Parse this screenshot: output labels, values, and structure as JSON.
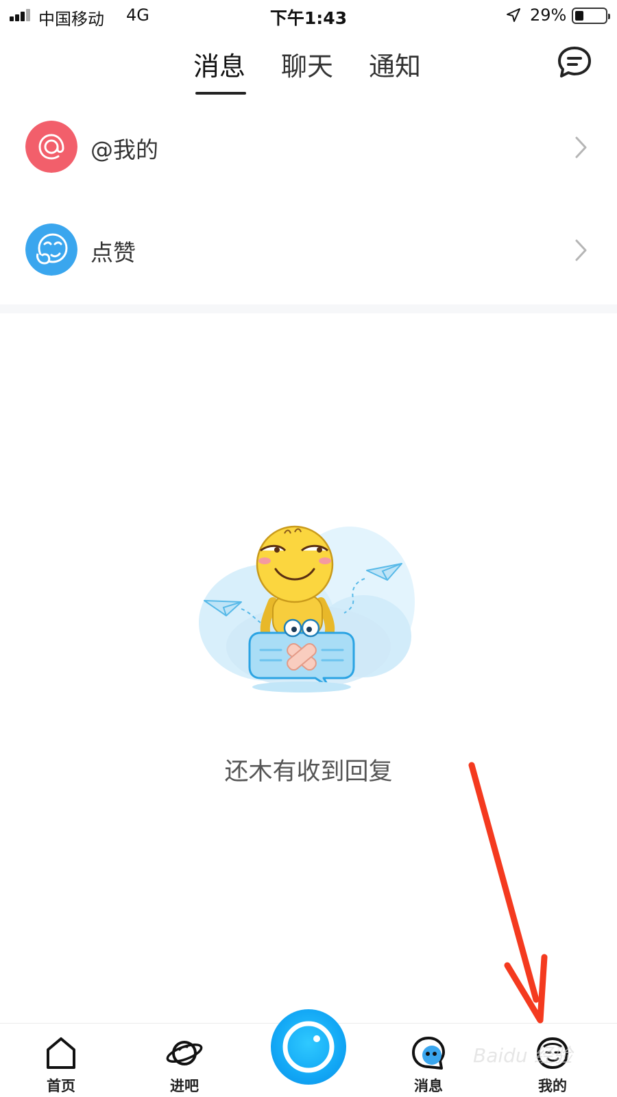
{
  "status_bar": {
    "carrier": "中国移动",
    "network": "4G",
    "time": "下午1:43",
    "battery_percent": "29%",
    "battery_level": 0.29
  },
  "top_tabs": {
    "items": [
      {
        "label": "消息",
        "active": true
      },
      {
        "label": "聊天",
        "active": false
      },
      {
        "label": "通知",
        "active": false
      }
    ],
    "compose_icon": "chat-bubble-icon"
  },
  "message_list": [
    {
      "label": "@我的",
      "icon": "at-icon",
      "color": "#f25f6b"
    },
    {
      "label": "点赞",
      "icon": "like-face-icon",
      "color": "#3aa6ee"
    }
  ],
  "empty_state": {
    "text": "还木有收到回复"
  },
  "tab_bar": {
    "items": [
      {
        "label": "首页",
        "icon": "home-icon"
      },
      {
        "label": "进吧",
        "icon": "planet-icon"
      },
      {
        "label": "",
        "icon": "camera-icon"
      },
      {
        "label": "消息",
        "icon": "message-bubble-icon"
      },
      {
        "label": "我的",
        "icon": "profile-face-icon"
      }
    ],
    "accent": "#12a7f5"
  },
  "watermark": "Baidu 经验",
  "annotation_color": "#f43a1f"
}
